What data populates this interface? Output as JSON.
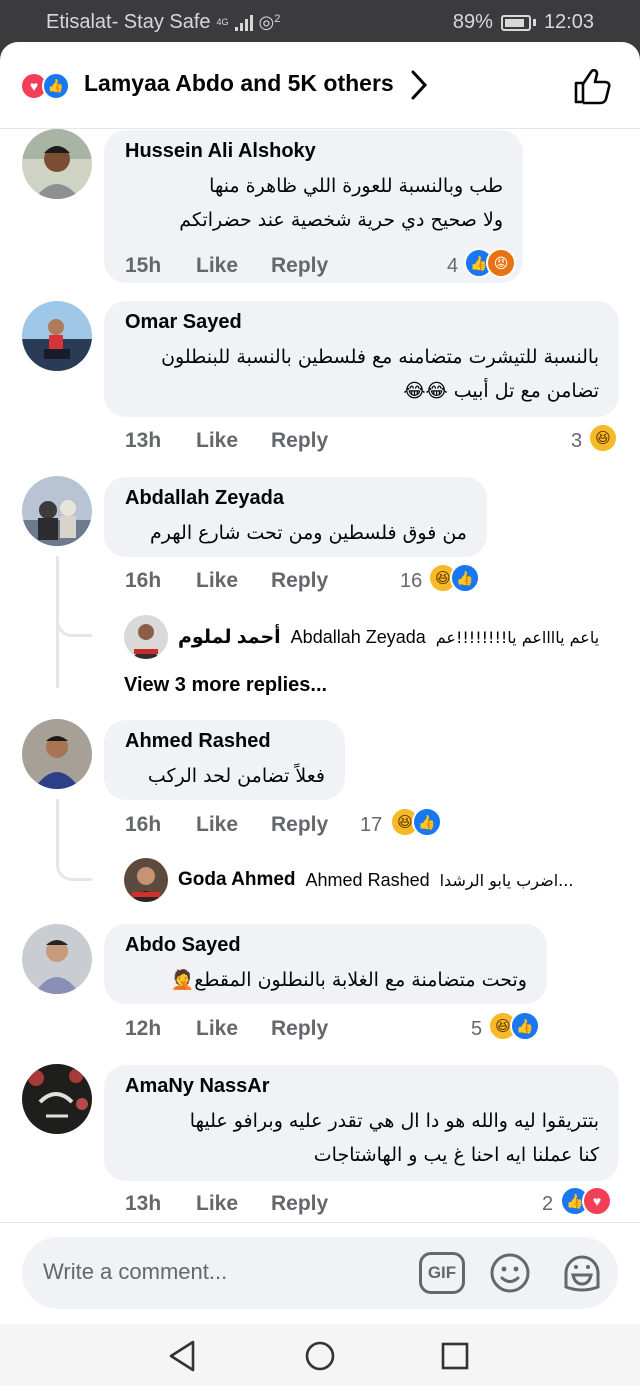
{
  "status_bar": {
    "carrier": "Etisalat- Stay Safe",
    "network": "4G",
    "battery": "89%",
    "time": "12:03",
    "superscript": "2"
  },
  "header": {
    "title": "Lamyaa Abdo and 5K others",
    "icons": [
      "love-reaction-icon",
      "like-reaction-icon",
      "chevron-right-icon",
      "thumbs-up-icon"
    ]
  },
  "actions": {
    "like": "Like",
    "reply": "Reply"
  },
  "comments": [
    {
      "author": "Hussein Ali Alshoky",
      "lines": [
        "طب وبالنسبة للعورة اللي ظاهرة منها",
        "ولا صحيح دي حرية شخصية عند حضراتكم"
      ],
      "time": "15h",
      "reaction_count": "4",
      "reactions": [
        "like",
        "angry"
      ]
    },
    {
      "author": "Omar Sayed",
      "lines": [
        "بالنسبة للتيشرت متضامنه مع فلسطين بالنسبة للبنطلون",
        "تضامن مع تل أبيب 😂😂"
      ],
      "time": "13h",
      "reaction_count": "3",
      "reactions": [
        "haha"
      ]
    },
    {
      "author": "Abdallah Zeyada",
      "lines": [
        "من فوق فلسطين ومن تحت شارع الهرم"
      ],
      "time": "16h",
      "reaction_count": "16",
      "reactions": [
        "haha",
        "like"
      ],
      "reply": {
        "author": "أحمد لملوم",
        "tag": "Abdallah Zeyada",
        "snippet": "ياعم يااااعم يا!!!!!!!!عم"
      },
      "view_more": "View 3 more replies..."
    },
    {
      "author": "Ahmed Rashed",
      "lines": [
        "فعلاً تضامن لحد الركب"
      ],
      "time": "16h",
      "reaction_count": "17",
      "reactions": [
        "haha",
        "like"
      ],
      "reply": {
        "author": "Goda Ahmed",
        "tag": "Ahmed Rashed",
        "snippet": "اضرب يابو الرشدا..."
      }
    },
    {
      "author": "Abdo Sayed",
      "lines": [
        "وتحت متضامنة مع الغلابة بالنطلون المقطع🤦"
      ],
      "time": "12h",
      "reaction_count": "5",
      "reactions": [
        "haha",
        "like"
      ]
    },
    {
      "author": "AmaNy NassAr",
      "lines": [
        "بتتريقوا ليه والله هو دا ال هي تقدر عليه وبرافو عليها",
        "كنا عملنا ايه احنا غ يب و الهاشتاجات"
      ],
      "time": "13h",
      "reaction_count": "2",
      "reactions": [
        "like",
        "love"
      ]
    }
  ],
  "composer": {
    "placeholder": "Write a comment...",
    "gif_label": "GIF"
  },
  "colors": {
    "facebook_blue": "#1877f2",
    "bubble_gray": "#f0f2f5",
    "meta_gray": "#65676b"
  }
}
